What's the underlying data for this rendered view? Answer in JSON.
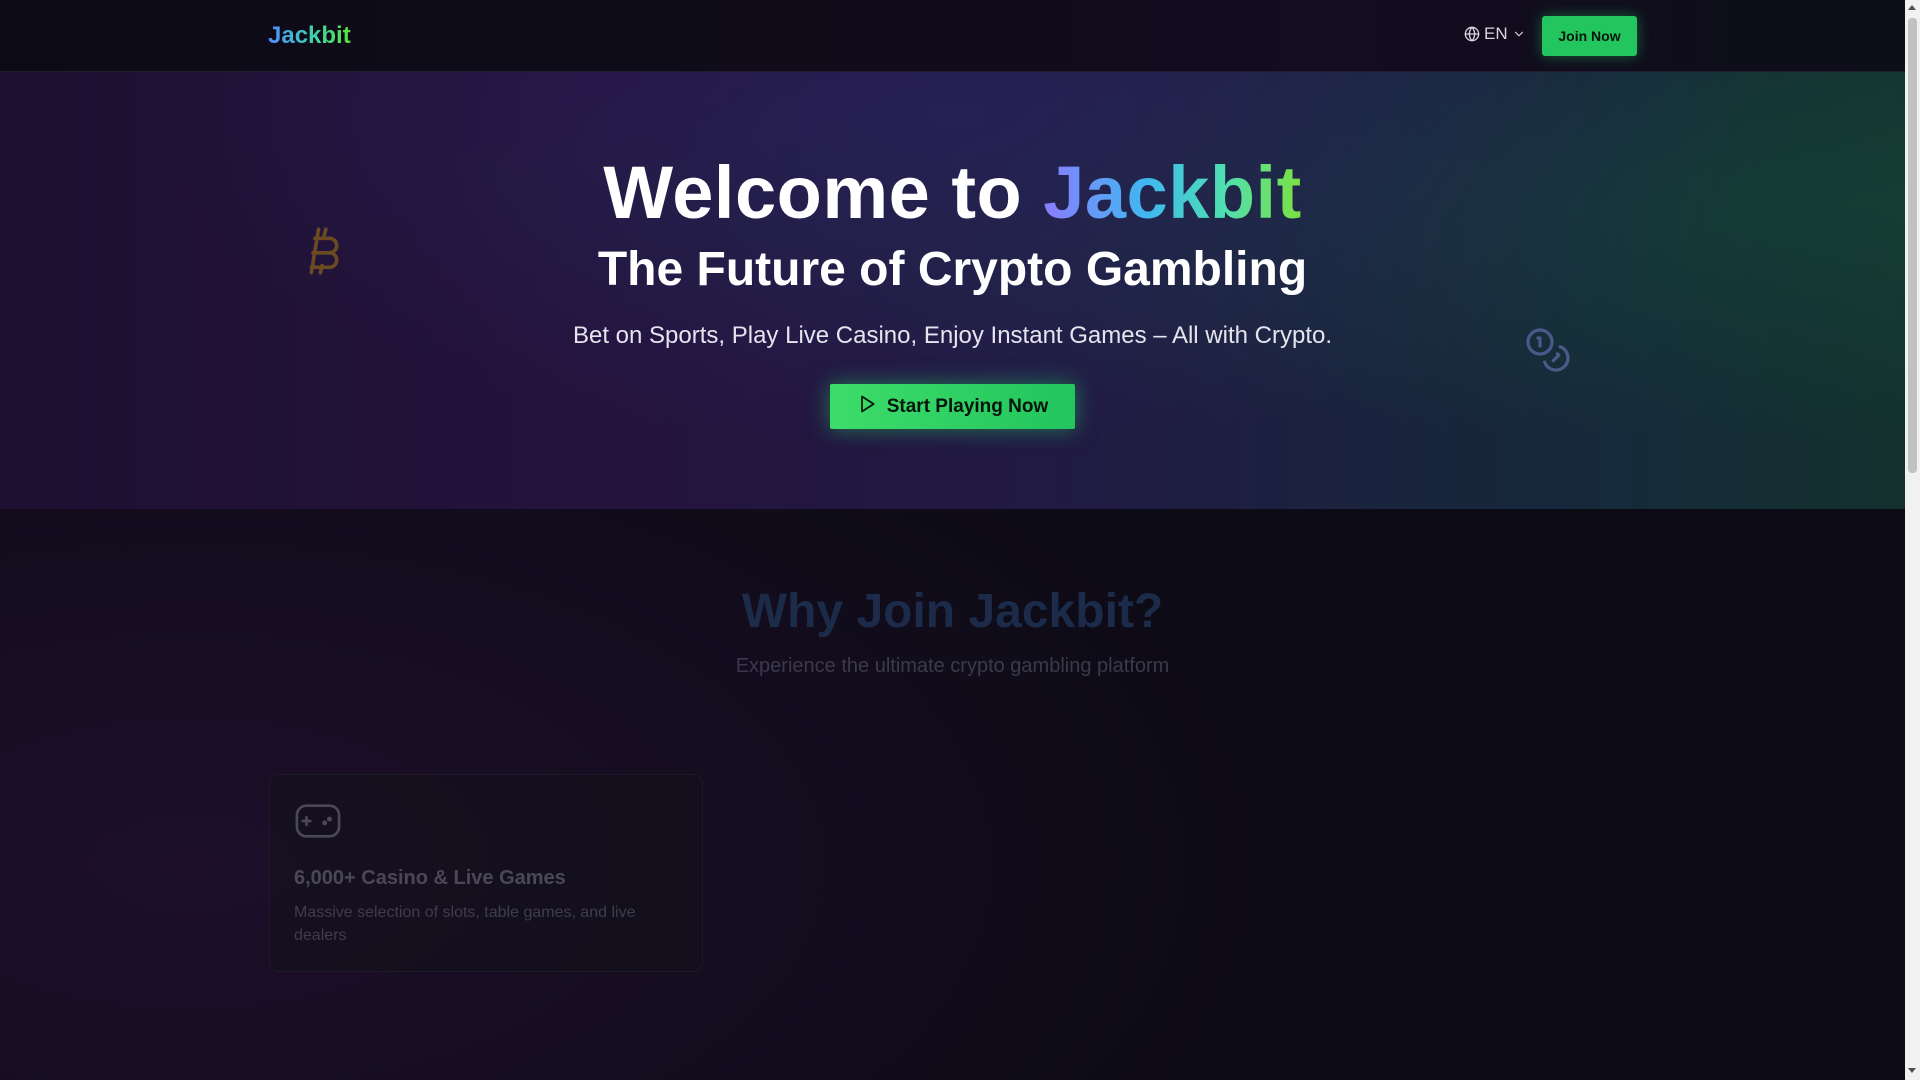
{
  "header": {
    "logo": "Jackbit",
    "language": "EN",
    "join_label": "Join Now"
  },
  "hero": {
    "title_prefix": "Welcome to",
    "title_brand": "Jackbit",
    "subtitle": "The Future of Crypto Gambling",
    "tagline": "Bet on Sports, Play Live Casino, Enjoy Instant Games – All with Crypto.",
    "cta_label": "Start Playing Now"
  },
  "why": {
    "title": "Why Join Jackbit?",
    "subtitle": "Experience the ultimate crypto gambling platform",
    "cards": [
      {
        "icon": "gamepad-icon",
        "title": "6,000+ Casino & Live Games",
        "description": "Massive selection of slots, table games, and live dealers"
      }
    ]
  },
  "colors": {
    "accent_green": "#22c55e",
    "brand_blue": "#4f8cff",
    "bitcoin_orange": "#6b4a22"
  }
}
